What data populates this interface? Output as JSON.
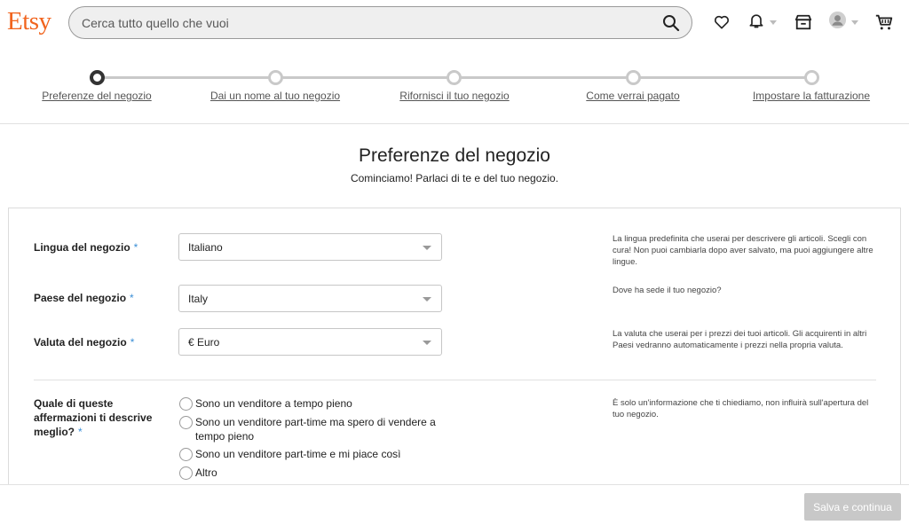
{
  "header": {
    "logo": "Etsy",
    "search_placeholder": "Cerca tutto quello che vuoi",
    "icons": [
      "search-icon",
      "heart-icon",
      "bell-icon",
      "shop-icon",
      "avatar",
      "cart-icon"
    ]
  },
  "stepper": {
    "steps": [
      {
        "label": "Preferenze del negozio",
        "active": true
      },
      {
        "label": "Dai un nome al tuo negozio",
        "active": false
      },
      {
        "label": "Rifornisci il tuo negozio",
        "active": false
      },
      {
        "label": "Come verrai pagato",
        "active": false
      },
      {
        "label": "Impostare la fatturazione",
        "active": false
      }
    ]
  },
  "page": {
    "title": "Preferenze del negozio",
    "subtitle": "Cominciamo! Parlaci di te e del tuo negozio."
  },
  "form": {
    "language": {
      "label": "Lingua del negozio",
      "required": "*",
      "value": "Italiano",
      "help": "La lingua predefinita che userai per descrivere gli articoli. Scegli con cura! Non puoi cambiarla dopo aver salvato, ma puoi aggiungere altre lingue."
    },
    "country": {
      "label": "Paese del negozio",
      "required": "*",
      "value": "Italy",
      "help": "Dove ha sede il tuo negozio?"
    },
    "currency": {
      "label": "Valuta del negozio",
      "required": "*",
      "value": "€ Euro",
      "help": "La valuta che userai per i prezzi dei tuoi articoli. Gli acquirenti in altri Paesi vedranno automaticamente i prezzi nella propria valuta."
    },
    "seller_type": {
      "label": "Quale di queste affermazioni ti descrive meglio?",
      "required": "*",
      "help": "È solo un'informazione che ti chiediamo, non influirà sull'apertura del tuo negozio.",
      "options": [
        "Sono un venditore a tempo pieno",
        "Sono un venditore part-time ma spero di vendere a tempo pieno",
        "Sono un venditore part-time e mi piace così",
        "Altro"
      ]
    }
  },
  "footer": {
    "save_label": "Salva e continua"
  },
  "colors": {
    "brand": "#F1641E",
    "required_mark": "#3b8fd6",
    "disabled_button": "#c8c8c8"
  }
}
